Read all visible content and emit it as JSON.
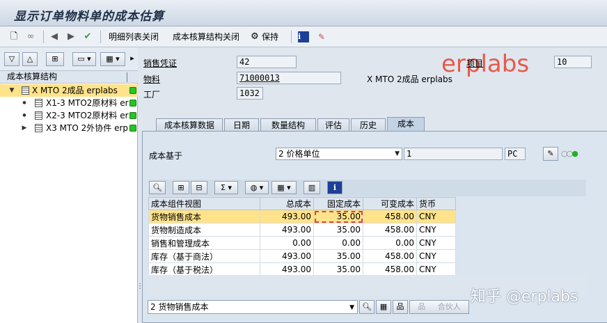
{
  "window": {
    "title": "显示订单物料单的成本估算"
  },
  "toolbar": {
    "detail_close": "明细列表关闭",
    "structure_close": "成本核算结构关闭",
    "keep": "保持",
    "info": "i"
  },
  "tree": {
    "header": "成本核算结构",
    "items": [
      {
        "label": "X MTO 2成品 erplabs",
        "selected": true
      },
      {
        "label": "X1-3 MTO2原材料 er"
      },
      {
        "label": "X2-3 MTO2原材料 er"
      },
      {
        "label": "X3 MTO 2外协件 erp"
      }
    ]
  },
  "header": {
    "sales_doc_label": "销售凭证",
    "sales_doc_value": "42",
    "item_label": "项目",
    "item_value": "10",
    "material_label": "物料",
    "material_value": "71000013",
    "material_desc": "X MTO 2成品 erplabs",
    "plant_label": "工厂",
    "plant_value": "1032",
    "watermark": "erplabs"
  },
  "tabs": [
    {
      "label": "成本核算数据"
    },
    {
      "label": "日期"
    },
    {
      "label": "数量结构"
    },
    {
      "label": "评估"
    },
    {
      "label": "历史"
    },
    {
      "label": "成本",
      "active": true
    }
  ],
  "cost_basis": {
    "label": "成本基于",
    "dropdown_value": "2 价格单位",
    "quantity": "1",
    "unit": "PC"
  },
  "grid": {
    "columns": [
      "成本组件视图",
      "总成本",
      "固定成本",
      "可变成本",
      "货币"
    ],
    "rows": [
      {
        "view": "货物销售成本",
        "total": "493.00",
        "fixed": "35.00",
        "variable": "458.00",
        "currency": "CNY"
      },
      {
        "view": "货物制造成本",
        "total": "493.00",
        "fixed": "35.00",
        "variable": "458.00",
        "currency": "CNY"
      },
      {
        "view": "销售和管理成本",
        "total": "0.00",
        "fixed": "0.00",
        "variable": "0.00",
        "currency": "CNY"
      },
      {
        "view": "库存（基于商法）",
        "total": "493.00",
        "fixed": "35.00",
        "variable": "458.00",
        "currency": "CNY"
      },
      {
        "view": "库存（基于税法）",
        "total": "493.00",
        "fixed": "35.00",
        "variable": "458.00",
        "currency": "CNY"
      }
    ]
  },
  "bottom": {
    "dropdown_value": "2 货物销售成本",
    "merge_button": "合伙人"
  },
  "overlay_watermark": "知乎 @erplabs"
}
